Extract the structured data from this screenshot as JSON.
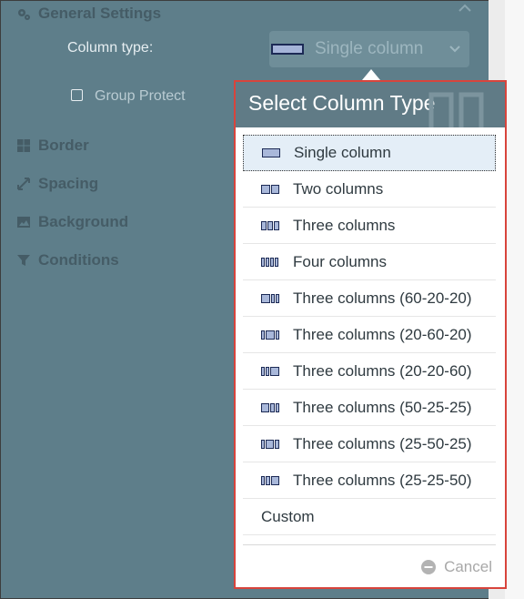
{
  "sections": {
    "general": "General Settings",
    "border": "Border",
    "spacing": "Spacing",
    "background": "Background",
    "conditions": "Conditions"
  },
  "column_type": {
    "label": "Column type:",
    "selected": "Single column"
  },
  "group_protect": {
    "label": "Group Protect",
    "checked": false
  },
  "popup": {
    "title": "Select Column Type",
    "options": [
      {
        "label": "Single column",
        "icon": "single-column-icon"
      },
      {
        "label": "Two columns",
        "icon": "two-columns-icon"
      },
      {
        "label": "Three columns",
        "icon": "three-columns-icon"
      },
      {
        "label": "Four columns",
        "icon": "four-columns-icon"
      },
      {
        "label": "Three columns (60-20-20)",
        "icon": "three-columns-60-20-20-icon"
      },
      {
        "label": "Three columns (20-60-20)",
        "icon": "three-columns-20-60-20-icon"
      },
      {
        "label": "Three columns (20-20-60)",
        "icon": "three-columns-20-20-60-icon"
      },
      {
        "label": "Three columns (50-25-25)",
        "icon": "three-columns-50-25-25-icon"
      },
      {
        "label": "Three columns (25-50-25)",
        "icon": "three-columns-25-50-25-icon"
      },
      {
        "label": "Three columns (25-25-50)",
        "icon": "three-columns-25-25-50-icon"
      },
      {
        "label": "Custom"
      }
    ],
    "cancel": "Cancel"
  },
  "colors": {
    "panel_bg": "#5e7e8a",
    "header_bg": "#607b86",
    "highlight_border": "#d8443c",
    "selected_bg": "#e4eef7"
  }
}
